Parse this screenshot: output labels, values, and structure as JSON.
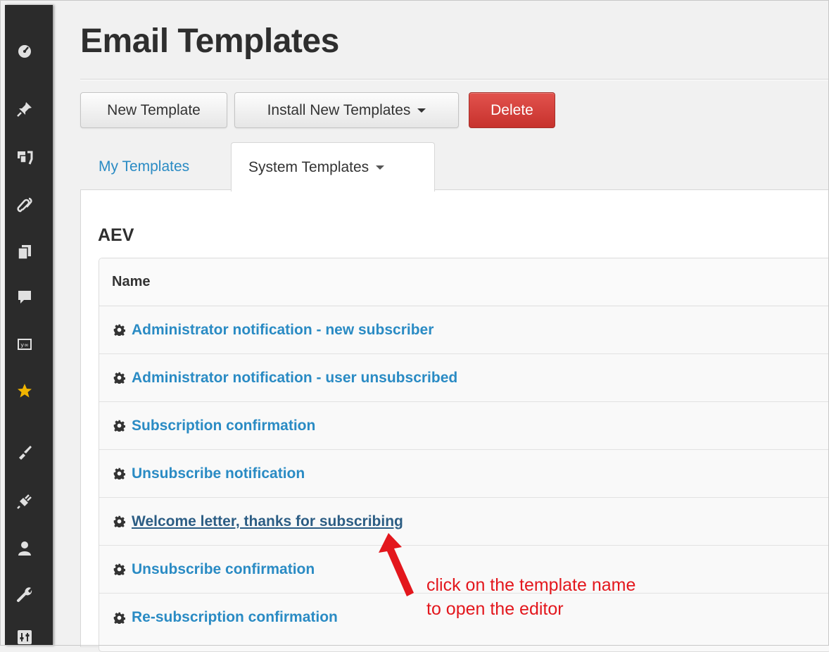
{
  "page": {
    "title": "Email Templates"
  },
  "toolbar": {
    "new_template_label": "New Template",
    "install_label": "Install New Templates",
    "delete_label": "Delete"
  },
  "tabs": {
    "my_templates": "My Templates",
    "system_templates": "System Templates"
  },
  "panel": {
    "group_title": "AEV",
    "table": {
      "column_header": "Name",
      "rows": [
        "Administrator notification - new subscriber",
        "Administrator notification - user unsubscribed",
        "Subscription confirmation",
        "Unsubscribe notification",
        "Welcome letter, thanks for subscribing",
        "Unsubscribe confirmation",
        "Re-subscription confirmation"
      ]
    }
  },
  "annotation": {
    "line1": "click on the template name",
    "line2": "to open the editor",
    "color": "#e3171d"
  },
  "sidebar": {
    "icons": [
      "dashboard-icon",
      "pin-icon",
      "media-icon",
      "link-icon",
      "pages-icon",
      "comment-icon",
      "forms-icon",
      "star-icon",
      "appearance-icon",
      "plugins-icon",
      "users-icon",
      "tools-icon",
      "settings-icon"
    ]
  },
  "colors": {
    "link": "#2a8bc4",
    "delete_button": "#d9453f",
    "sidebar_bg": "#2b2b2b"
  }
}
